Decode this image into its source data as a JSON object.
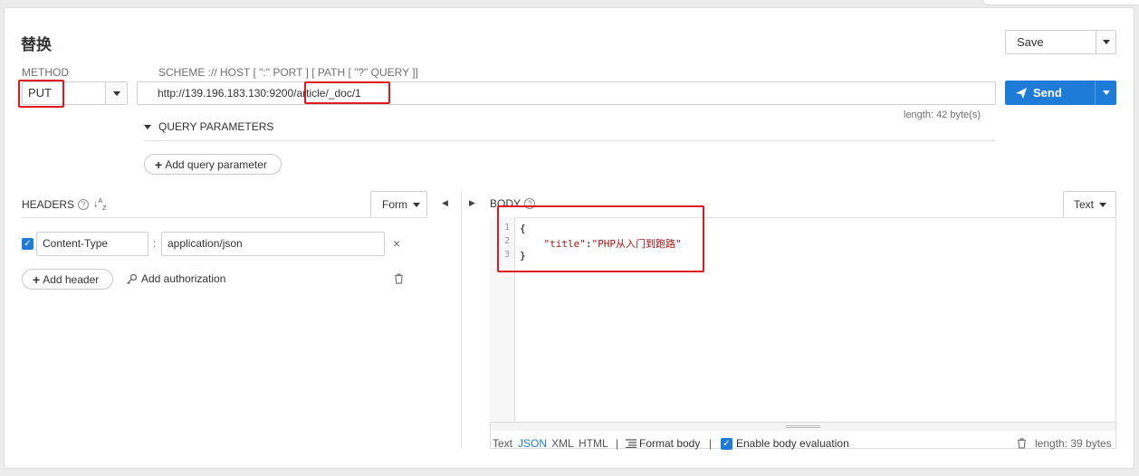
{
  "title": "替换",
  "save": {
    "label": "Save"
  },
  "method": {
    "label": "METHOD",
    "value": "PUT"
  },
  "url": {
    "label": "SCHEME :// HOST [ \":\" PORT ] [ PATH [ \"?\" QUERY ]]",
    "value_prefix": "http://139.196.183.130:9200",
    "value_path": "/article/_doc/1",
    "length": "length: 42 byte(s)"
  },
  "send": {
    "label": "Send"
  },
  "query": {
    "label": "QUERY PARAMETERS",
    "add_label": "Add query parameter"
  },
  "headers": {
    "label": "HEADERS",
    "help": "?",
    "sort": "↓A/Z",
    "form_label": "Form",
    "items": [
      {
        "name": "Content-Type",
        "value": "application/json",
        "sep": ":"
      }
    ],
    "remove": "×",
    "add_label": "Add header",
    "auth_label": "Add authorization"
  },
  "body": {
    "label": "BODY",
    "help": "?",
    "mode_label": "Text",
    "lines": [
      {
        "num": "1",
        "text": "{"
      },
      {
        "num": "2",
        "indent": "    ",
        "key": "\"title\"",
        "colon": ":",
        "val": "\"PHP从入门到跑路\""
      },
      {
        "num": "3",
        "text": "}"
      }
    ],
    "footer": {
      "text": "Text",
      "json": "JSON",
      "xml": "XML",
      "html": "HTML",
      "sep": "|",
      "format": "Format body",
      "enable": "Enable body evaluation",
      "length": "length: 39 bytes"
    }
  },
  "icons": {
    "collapse_left": "◀",
    "collapse_right": "▶",
    "trash": "trash-icon",
    "key": "key-icon"
  },
  "colors": {
    "accent": "#1f7bd8",
    "highlight": "#e0191f"
  }
}
